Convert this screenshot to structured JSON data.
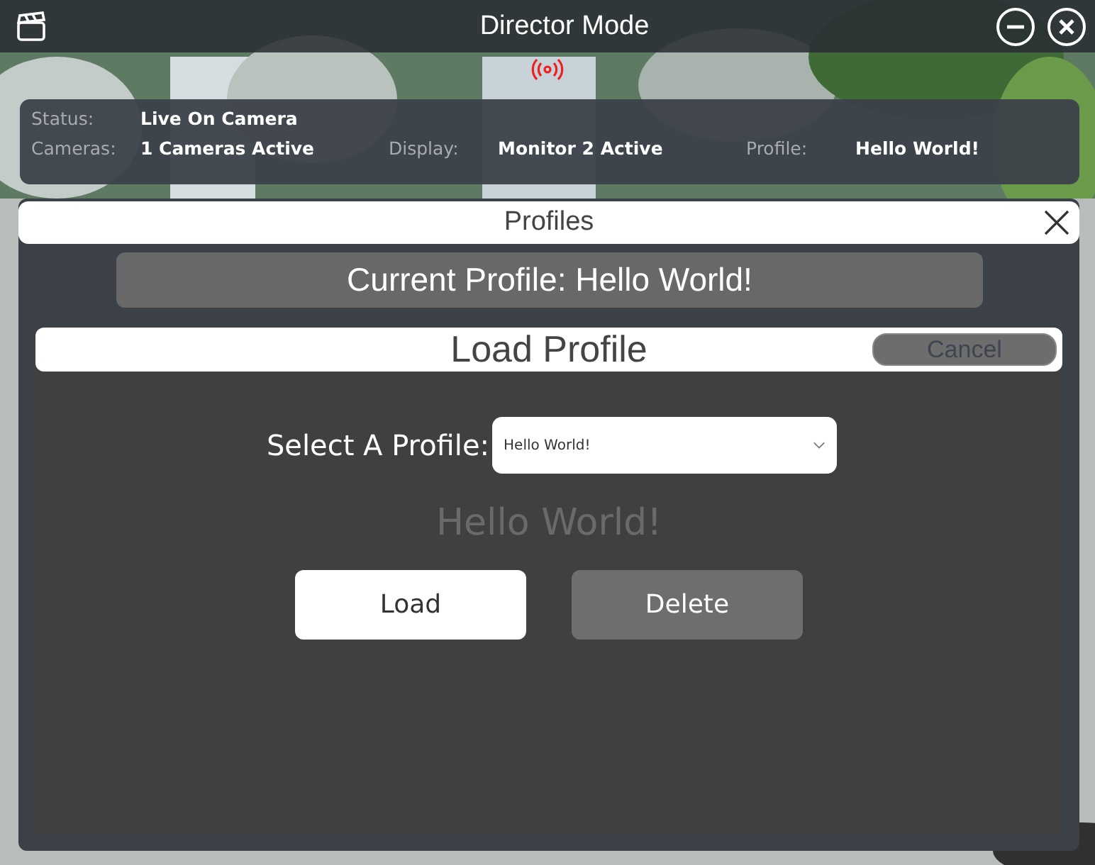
{
  "window": {
    "title": "Director Mode"
  },
  "status": {
    "status_label": "Status:",
    "status_value": "Live On Camera",
    "fields": [
      {
        "label": "Cameras:",
        "value": "1 Cameras Active"
      },
      {
        "label": "Display:",
        "value": "Monitor 2 Active"
      },
      {
        "label": "Profile:",
        "value": "Hello World!"
      }
    ]
  },
  "profiles_panel": {
    "title": "Profiles",
    "current_profile": "Current Profile:  Hello World!",
    "load_dialog": {
      "title": "Load Profile",
      "cancel": "Cancel",
      "select_label": "Select A Profile:",
      "select_value": "Hello World!",
      "preview": "Hello World!",
      "buttons": [
        {
          "label": "Load",
          "kind": "primary"
        },
        {
          "label": "Delete",
          "kind": "secondary"
        }
      ]
    }
  }
}
